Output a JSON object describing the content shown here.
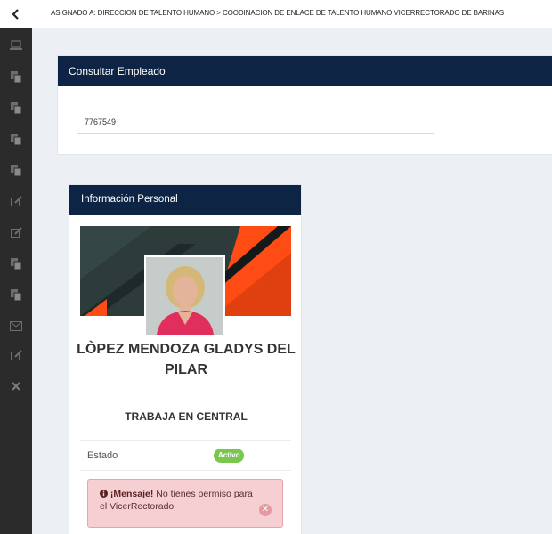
{
  "breadcrumb": "ASIGNADO A: DIRECCION DE TALENTO HUMANO > COODINACION DE ENLACE DE TALENTO HUMANO VICERRECTORADO DE BARINAS",
  "sidebar": {
    "icons": [
      "laptop-icon",
      "copy-icon",
      "copy-icon",
      "copy-icon",
      "copy-icon",
      "edit-icon",
      "edit-icon",
      "copy-icon",
      "copy-icon",
      "envelope-icon",
      "edit-icon",
      "close-icon"
    ]
  },
  "search_panel": {
    "title": "Consultar Empleado",
    "input_value": "7767549"
  },
  "profile": {
    "header": "Información Personal",
    "name": "LÒPEZ MENDOZA GLADYS DEL PILAR",
    "works_at": "TRABAJA EN CENTRAL",
    "status_label": "Estado",
    "status_value": "Activo",
    "alert_title": "¡Mensaje!",
    "alert_text": "No tienes permiso para el VicerRectorado"
  },
  "colors": {
    "header_navy": "#0d2444",
    "sidebar": "#2b2b2b",
    "active_badge": "#7ac74f",
    "alert_bg": "#f6cfd3",
    "banner_accent": "#ff4b14"
  }
}
